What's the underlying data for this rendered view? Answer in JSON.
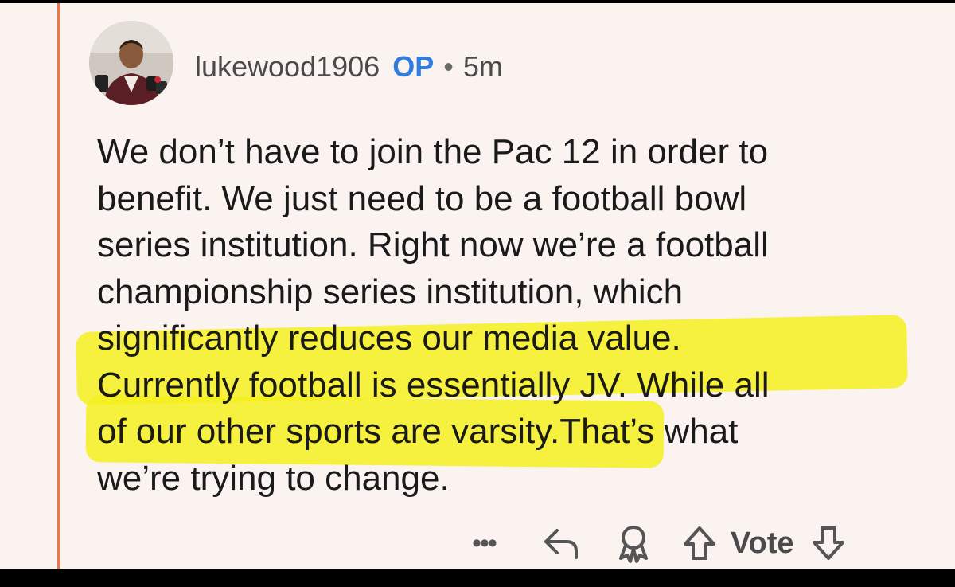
{
  "comment": {
    "username": "lukewood1906",
    "op_badge": "OP",
    "separator": "•",
    "timestamp": "5m",
    "body_lines": [
      "We don’t have to join the Pac 12 in order to",
      "benefit. We just need to be a football bowl",
      "series institution. Right now we’re a football",
      "championship series institution, which",
      "significantly reduces our media value.",
      "Currently football is essentially JV. While all",
      "of our other sports are varsity.That’s what",
      "we’re trying to change."
    ]
  },
  "actions": {
    "more_label": "•••",
    "vote_label": "Vote",
    "icons": [
      "more-icon",
      "reply-icon",
      "award-icon",
      "upvote-icon",
      "downvote-icon"
    ]
  },
  "colors": {
    "background": "#faf3f0",
    "thread_line": "#df7a52",
    "op_badge": "#2f7de1",
    "highlight": "#f4f020",
    "text": "#1a1a1a"
  }
}
